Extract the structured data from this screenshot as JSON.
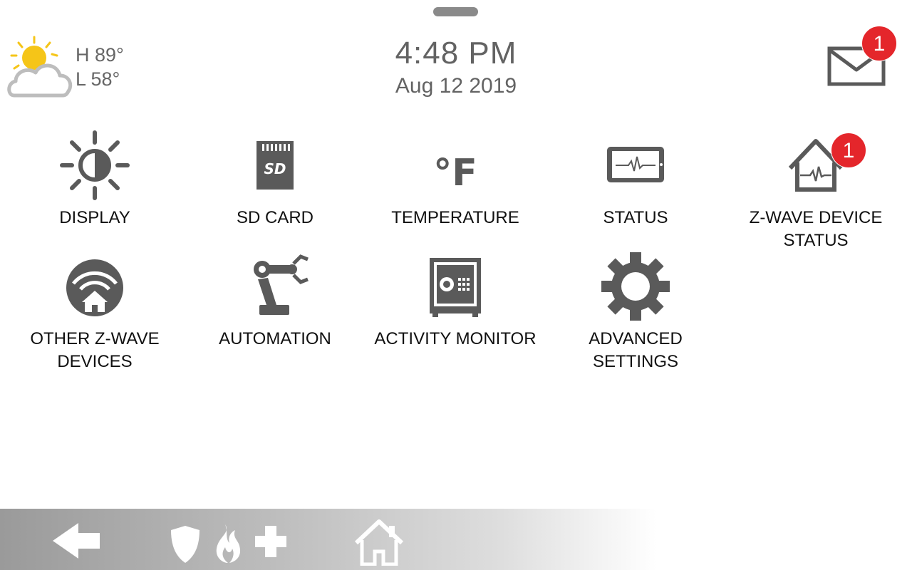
{
  "weather": {
    "high": "H 89°",
    "low": "L 58°",
    "icon": "partly-cloudy-icon"
  },
  "clock": {
    "time": "4:48 PM",
    "date": "Aug 12 2019"
  },
  "messages": {
    "icon": "mail-icon",
    "badge_count": "1"
  },
  "tiles": [
    {
      "label": "DISPLAY",
      "icon": "brightness-icon"
    },
    {
      "label": "SD CARD",
      "icon": "sd-card-icon"
    },
    {
      "label": "TEMPERATURE",
      "icon": "fahrenheit-icon",
      "icon_text": "°F"
    },
    {
      "label": "STATUS",
      "icon": "tablet-pulse-icon"
    },
    {
      "label": "Z-WAVE DEVICE STATUS",
      "icon": "house-pulse-icon",
      "badge_count": "1"
    },
    {
      "label": "OTHER Z-WAVE DEVICES",
      "icon": "wifi-house-icon"
    },
    {
      "label": "AUTOMATION",
      "icon": "robot-arm-icon"
    },
    {
      "label": "ACTIVITY MONITOR",
      "icon": "safe-icon"
    },
    {
      "label": "ADVANCED SETTINGS",
      "icon": "gear-icon"
    }
  ],
  "bottom_bar": {
    "back_icon": "back-arrow-icon",
    "emergency_icons": [
      "shield-icon",
      "fire-icon",
      "medical-cross-icon"
    ],
    "home_icon": "home-icon"
  },
  "colors": {
    "icon_gray": "#5a5a5a",
    "badge_red": "#e4262b",
    "sun_yellow": "#f5c518"
  }
}
